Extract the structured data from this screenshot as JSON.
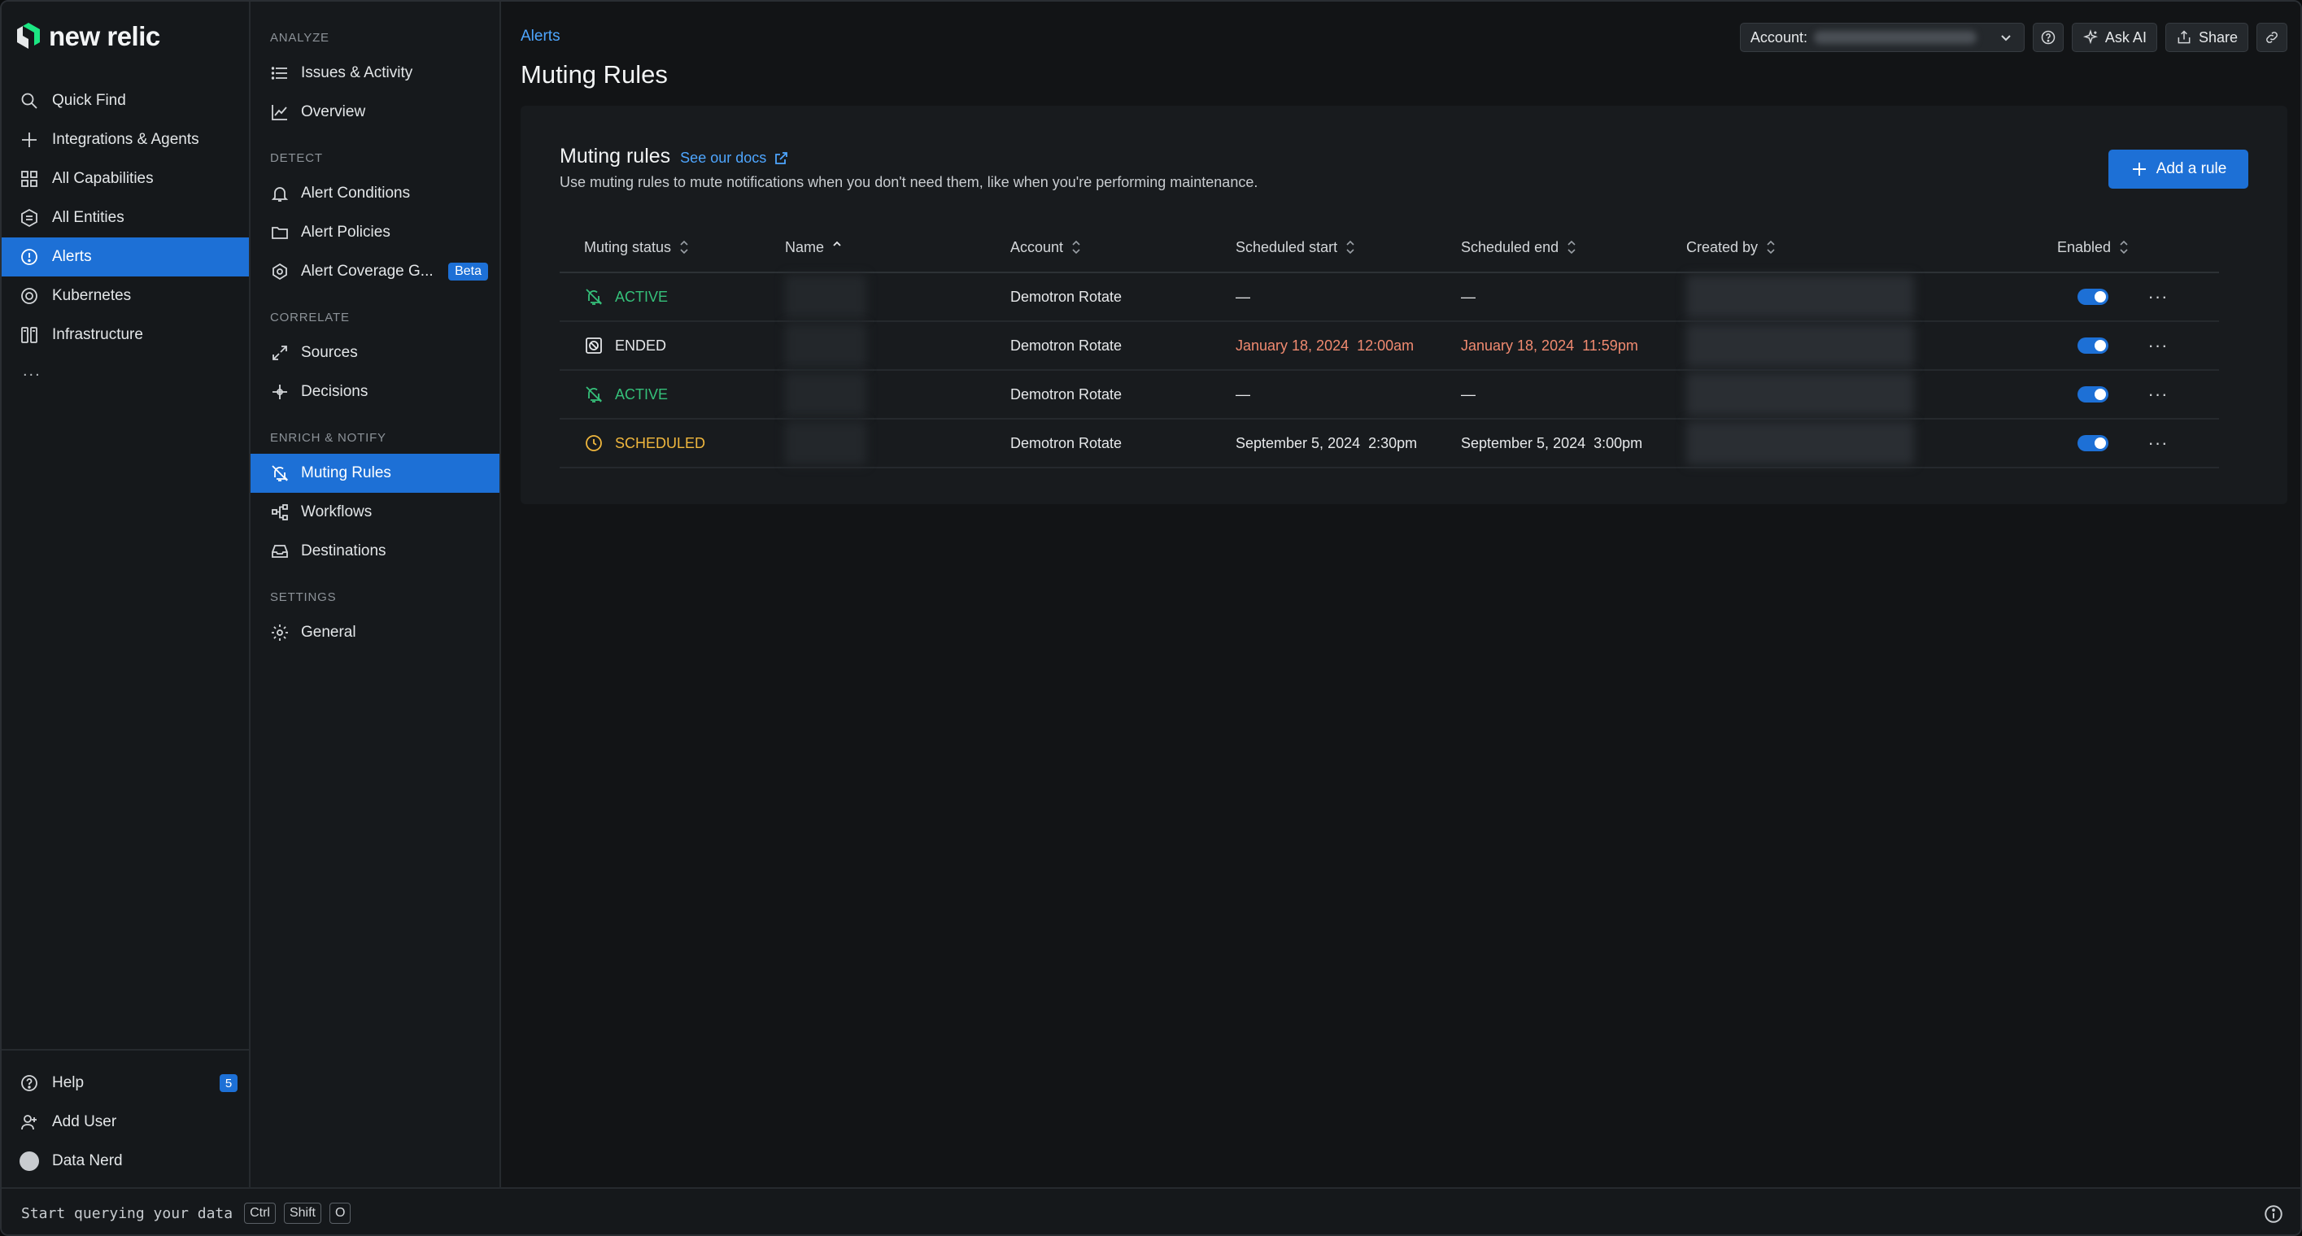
{
  "brand": {
    "logo_text": "new relic"
  },
  "global_nav": {
    "items": [
      {
        "label": "Quick Find",
        "icon": "search-icon"
      },
      {
        "label": "Integrations & Agents",
        "icon": "plus-icon"
      },
      {
        "label": "All Capabilities",
        "icon": "grid-icon"
      },
      {
        "label": "All Entities",
        "icon": "entities-icon"
      },
      {
        "label": "Alerts",
        "icon": "alert-icon",
        "active": true
      },
      {
        "label": "Kubernetes",
        "icon": "kubernetes-icon"
      },
      {
        "label": "Infrastructure",
        "icon": "infrastructure-icon"
      }
    ],
    "more_label": "...",
    "bottom": {
      "help_label": "Help",
      "help_badge": "5",
      "add_user_label": "Add User",
      "user_label": "Data Nerd"
    }
  },
  "secondary_nav": {
    "sections": {
      "analyze": "ANALYZE",
      "detect": "DETECT",
      "correlate": "CORRELATE",
      "enrich": "ENRICH & NOTIFY",
      "settings": "SETTINGS"
    },
    "items": {
      "issues": "Issues & Activity",
      "overview": "Overview",
      "alert_conditions": "Alert Conditions",
      "alert_policies": "Alert Policies",
      "alert_coverage": "Alert Coverage G...",
      "beta_badge": "Beta",
      "sources": "Sources",
      "decisions": "Decisions",
      "muting_rules": "Muting Rules",
      "workflows": "Workflows",
      "destinations": "Destinations",
      "general": "General"
    }
  },
  "header": {
    "breadcrumb": "Alerts",
    "title": "Muting Rules",
    "account_label": "Account:",
    "ask_ai_label": "Ask AI",
    "share_label": "Share"
  },
  "card": {
    "title": "Muting rules",
    "docs_link": "See our docs",
    "description": "Use muting rules to mute notifications when you don't need them, like when you're performing maintenance.",
    "add_button": "Add a rule"
  },
  "table": {
    "columns": {
      "status": "Muting status",
      "name": "Name",
      "account": "Account",
      "start": "Scheduled start",
      "end": "Scheduled end",
      "created_by": "Created by",
      "enabled": "Enabled"
    },
    "rows": [
      {
        "status": "ACTIVE",
        "status_type": "active",
        "account": "Demotron Rotate",
        "start": "—",
        "end": "—",
        "enabled": true
      },
      {
        "status": "ENDED",
        "status_type": "ended",
        "account": "Demotron Rotate",
        "start": "January 18, 2024  12:00am",
        "end": "January 18, 2024  11:59pm",
        "enabled": true
      },
      {
        "status": "ACTIVE",
        "status_type": "active",
        "account": "Demotron Rotate",
        "start": "—",
        "end": "—",
        "enabled": true
      },
      {
        "status": "SCHEDULED",
        "status_type": "scheduled",
        "account": "Demotron Rotate",
        "start": "September 5, 2024  2:30pm",
        "end": "September 5, 2024  3:00pm",
        "enabled": true
      }
    ]
  },
  "bottom_bar": {
    "query_text": "Start querying your data",
    "keys": [
      "Ctrl",
      "Shift",
      "O"
    ]
  },
  "colors": {
    "accent": "#1d70d6",
    "active": "#35c07a",
    "scheduled": "#f0b73d",
    "ended_date": "#f08a70"
  }
}
